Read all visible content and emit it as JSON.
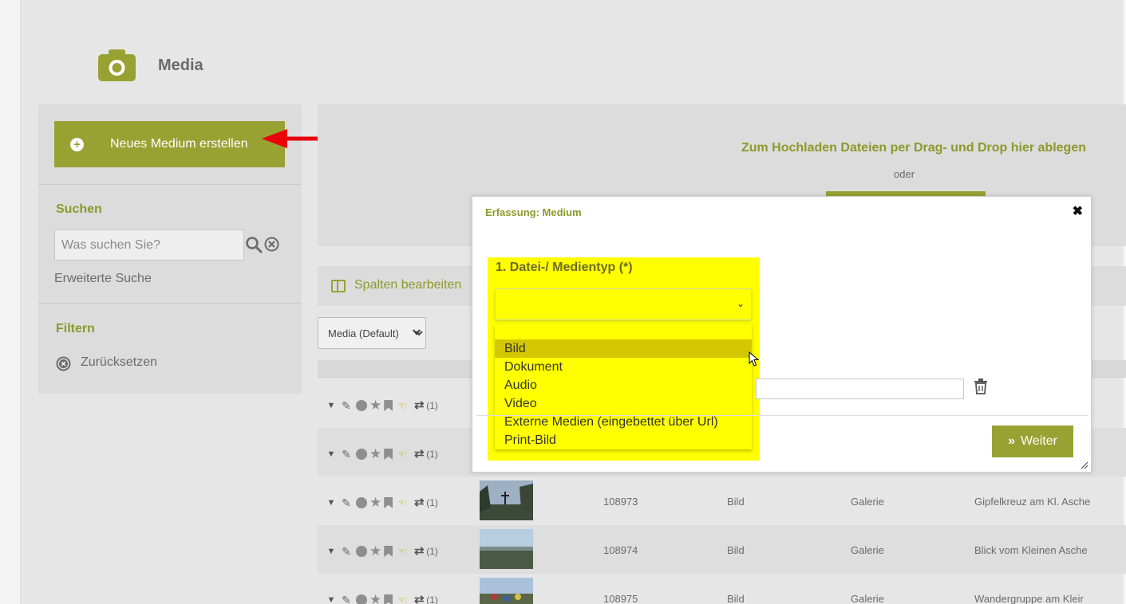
{
  "page": {
    "title": "Media",
    "header_icon": "camera-icon"
  },
  "sidebar": {
    "new_button_label": "Neues Medium erstellen",
    "search_heading": "Suchen",
    "search_placeholder": "Was suchen Sie?",
    "advanced_search": "Erweiterte Suche",
    "filter_heading": "Filtern",
    "reset_label": "Zurücksetzen"
  },
  "upload": {
    "title": "Zum Hochladen Dateien per Drag- und Drop hier ablegen",
    "or": "oder"
  },
  "columns": {
    "edit_label": "Spalten bearbeiten"
  },
  "view_select": {
    "value": "Media (Default)"
  },
  "rows": [
    {
      "count": "(1)",
      "id": "",
      "type": "",
      "category": "",
      "title": ""
    },
    {
      "count": "(1)",
      "id": "",
      "type": "",
      "category": "",
      "title": ""
    },
    {
      "count": "(1)",
      "id": "108973",
      "type": "Bild",
      "category": "Galerie",
      "title": "Gipfelkreuz am Kl. Asche"
    },
    {
      "count": "(1)",
      "id": "108974",
      "type": "Bild",
      "category": "Galerie",
      "title": "Blick vom Kleinen Asche"
    },
    {
      "count": "(1)",
      "id": "108975",
      "type": "Bild",
      "category": "Galerie",
      "title": "Wandergruppe am Kleir"
    }
  ],
  "modal": {
    "title": "Erfassung: Medium",
    "field_label": "1. Datei-/ Medientyp (*)",
    "selected_value": "",
    "options": [
      "",
      "Bild",
      "Dokument",
      "Audio",
      "Video",
      "Externe Medien (eingebettet über Url)",
      "Print-Bild"
    ],
    "highlighted_option": "Bild",
    "next_button": "Weiter"
  },
  "colors": {
    "accent": "#98a233",
    "accent_text": "#8a9a2b",
    "highlight": "#ffff00",
    "selected_option": "#d3c800",
    "annotation_arrow": "#e8000b"
  }
}
